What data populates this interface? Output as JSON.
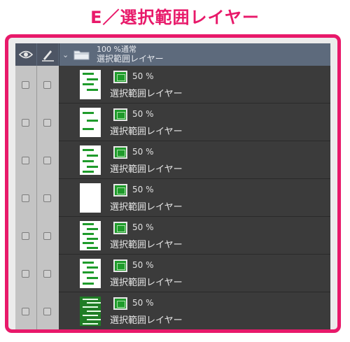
{
  "page_title": "E／選択範囲レイヤー",
  "colors": {
    "accent": "#e8196a",
    "mask_green": "#1f9b2b",
    "header_bg": "#5d6a7c"
  },
  "header": {
    "icons": [
      "eye-icon",
      "pen-icon",
      "chevron-down-icon",
      "folder-icon"
    ],
    "opacity_blend": "100 %通常",
    "folder_name": "選択範囲レイヤー"
  },
  "layers": [
    {
      "opacity": "50 %",
      "name": "選択範囲レイヤー"
    },
    {
      "opacity": "50 %",
      "name": "選択範囲レイヤー"
    },
    {
      "opacity": "50 %",
      "name": "選択範囲レイヤー"
    },
    {
      "opacity": "50 %",
      "name": "選択範囲レイヤー"
    },
    {
      "opacity": "50 %",
      "name": "選択範囲レイヤー"
    },
    {
      "opacity": "50 %",
      "name": "選択範囲レイヤー"
    },
    {
      "opacity": "50 %",
      "name": "選択範囲レイヤー"
    }
  ]
}
